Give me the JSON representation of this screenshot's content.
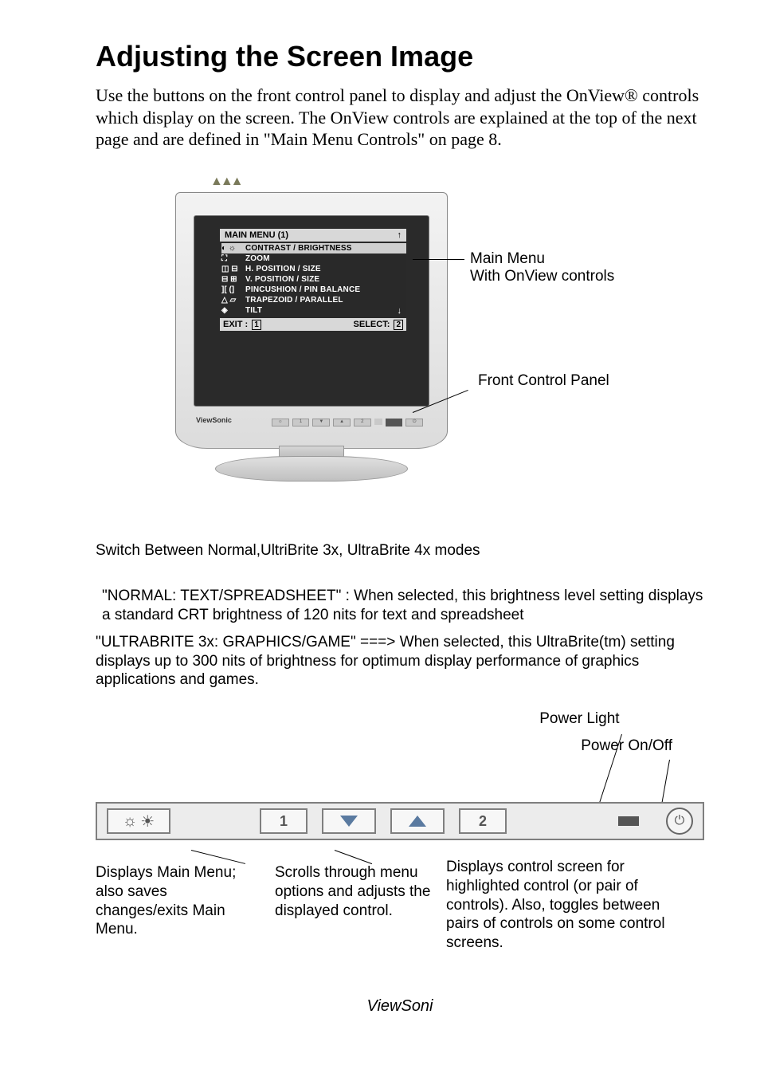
{
  "title": "Adjusting the Screen Image",
  "intro": "Use the buttons on the front control panel to display and adjust the OnView® controls which display on the screen. The OnView controls are explained at the top of the next page and are defined in \"Main Menu Controls\" on page  8.",
  "osd": {
    "title": "MAIN MENU (1)",
    "items": [
      {
        "icons": "◐ ☼",
        "label": "CONTRAST / BRIGHTNESS",
        "highlight": true
      },
      {
        "icons": "⛶",
        "label": "ZOOM"
      },
      {
        "icons": "◫ ⊟",
        "label": "H. POSITION / SIZE"
      },
      {
        "icons": "⊟ ⊞",
        "label": "V. POSITION / SIZE"
      },
      {
        "icons": "][ (]",
        "label": "PINCUSHION / PIN BALANCE"
      },
      {
        "icons": "△ ▱",
        "label": "TRAPEZOID / PARALLEL"
      },
      {
        "icons": "◈",
        "label": "TILT"
      }
    ],
    "footer_exit": "EXIT :",
    "footer_exit_key": "1",
    "footer_select": "SELECT:",
    "footer_select_key": "2"
  },
  "monitor_brand": "ViewSonic",
  "callout_mainmenu_l1": "Main Menu",
  "callout_mainmenu_l2": "With OnView controls",
  "callout_panel": "Front Control Panel",
  "mid_switch": "Switch Between Normal,UltriBrite 3x, UltraBrite 4x modes",
  "mid_normal": "\"NORMAL: TEXT/SPREADSHEET\" : When selected, this brightness level setting displays a standard CRT brightness of 120 nits for text and spreadsheet",
  "mid_ultra": "\"ULTRABRITE 3x: GRAPHICS/GAME\"  ===> When selected, this UltraBrite(tm) setting displays up to 300 nits of brightness for optimum display performance of graphics applications and games.",
  "panel": {
    "power_light_label": "Power Light",
    "power_onoff_label": "Power On/Off",
    "btn1": "1",
    "btn2": "2",
    "desc1": "Displays Main Menu; also saves changes/exits Main Menu.",
    "desc2": "Scrolls through menu options and adjusts the displayed control.",
    "desc3": "Displays control screen for highlighted control (or pair of controls). Also, toggles between pairs of controls on some control screens."
  },
  "footer": "ViewSoni"
}
